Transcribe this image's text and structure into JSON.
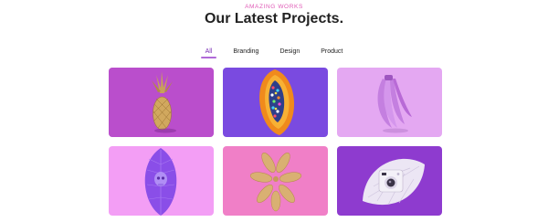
{
  "header": {
    "eyebrow": "AMAZING WORKS",
    "title": "Our Latest Projects."
  },
  "filters": [
    {
      "label": "All",
      "active": true
    },
    {
      "label": "Branding",
      "active": false
    },
    {
      "label": "Design",
      "active": false
    },
    {
      "label": "Product",
      "active": false
    }
  ],
  "projects": [
    {
      "subject": "pineapple",
      "background": "#b545c8"
    },
    {
      "subject": "papaya",
      "background": "#7a4ae0"
    },
    {
      "subject": "bananas",
      "background": "#e4a8f2"
    },
    {
      "subject": "leaf-skull",
      "background": "#f39ef5"
    },
    {
      "subject": "golden-leaves",
      "background": "#f07fc7"
    },
    {
      "subject": "camera-leaf",
      "background": "#8e3bcf"
    }
  ],
  "colors": {
    "accent": "#e05ab6",
    "active_filter": "#7b2fb6",
    "title": "#222222"
  }
}
